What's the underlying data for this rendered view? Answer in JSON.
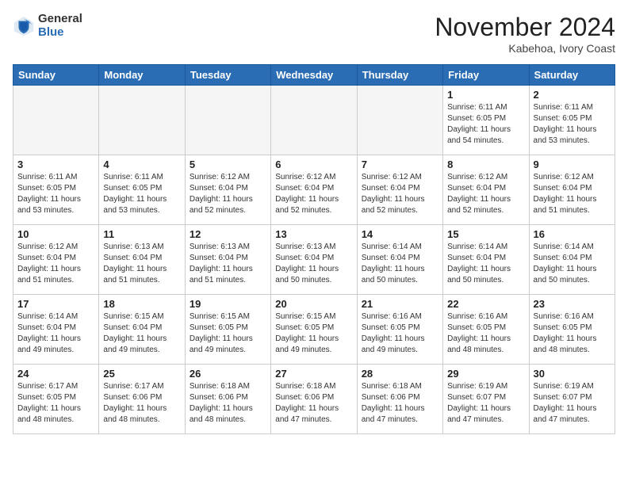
{
  "logo": {
    "general": "General",
    "blue": "Blue"
  },
  "header": {
    "month": "November 2024",
    "location": "Kabehoa, Ivory Coast"
  },
  "days_of_week": [
    "Sunday",
    "Monday",
    "Tuesday",
    "Wednesday",
    "Thursday",
    "Friday",
    "Saturday"
  ],
  "weeks": [
    [
      {
        "day": "",
        "info": ""
      },
      {
        "day": "",
        "info": ""
      },
      {
        "day": "",
        "info": ""
      },
      {
        "day": "",
        "info": ""
      },
      {
        "day": "",
        "info": ""
      },
      {
        "day": "1",
        "info": "Sunrise: 6:11 AM\nSunset: 6:05 PM\nDaylight: 11 hours\nand 54 minutes."
      },
      {
        "day": "2",
        "info": "Sunrise: 6:11 AM\nSunset: 6:05 PM\nDaylight: 11 hours\nand 53 minutes."
      }
    ],
    [
      {
        "day": "3",
        "info": "Sunrise: 6:11 AM\nSunset: 6:05 PM\nDaylight: 11 hours\nand 53 minutes."
      },
      {
        "day": "4",
        "info": "Sunrise: 6:11 AM\nSunset: 6:05 PM\nDaylight: 11 hours\nand 53 minutes."
      },
      {
        "day": "5",
        "info": "Sunrise: 6:12 AM\nSunset: 6:04 PM\nDaylight: 11 hours\nand 52 minutes."
      },
      {
        "day": "6",
        "info": "Sunrise: 6:12 AM\nSunset: 6:04 PM\nDaylight: 11 hours\nand 52 minutes."
      },
      {
        "day": "7",
        "info": "Sunrise: 6:12 AM\nSunset: 6:04 PM\nDaylight: 11 hours\nand 52 minutes."
      },
      {
        "day": "8",
        "info": "Sunrise: 6:12 AM\nSunset: 6:04 PM\nDaylight: 11 hours\nand 52 minutes."
      },
      {
        "day": "9",
        "info": "Sunrise: 6:12 AM\nSunset: 6:04 PM\nDaylight: 11 hours\nand 51 minutes."
      }
    ],
    [
      {
        "day": "10",
        "info": "Sunrise: 6:12 AM\nSunset: 6:04 PM\nDaylight: 11 hours\nand 51 minutes."
      },
      {
        "day": "11",
        "info": "Sunrise: 6:13 AM\nSunset: 6:04 PM\nDaylight: 11 hours\nand 51 minutes."
      },
      {
        "day": "12",
        "info": "Sunrise: 6:13 AM\nSunset: 6:04 PM\nDaylight: 11 hours\nand 51 minutes."
      },
      {
        "day": "13",
        "info": "Sunrise: 6:13 AM\nSunset: 6:04 PM\nDaylight: 11 hours\nand 50 minutes."
      },
      {
        "day": "14",
        "info": "Sunrise: 6:14 AM\nSunset: 6:04 PM\nDaylight: 11 hours\nand 50 minutes."
      },
      {
        "day": "15",
        "info": "Sunrise: 6:14 AM\nSunset: 6:04 PM\nDaylight: 11 hours\nand 50 minutes."
      },
      {
        "day": "16",
        "info": "Sunrise: 6:14 AM\nSunset: 6:04 PM\nDaylight: 11 hours\nand 50 minutes."
      }
    ],
    [
      {
        "day": "17",
        "info": "Sunrise: 6:14 AM\nSunset: 6:04 PM\nDaylight: 11 hours\nand 49 minutes."
      },
      {
        "day": "18",
        "info": "Sunrise: 6:15 AM\nSunset: 6:04 PM\nDaylight: 11 hours\nand 49 minutes."
      },
      {
        "day": "19",
        "info": "Sunrise: 6:15 AM\nSunset: 6:05 PM\nDaylight: 11 hours\nand 49 minutes."
      },
      {
        "day": "20",
        "info": "Sunrise: 6:15 AM\nSunset: 6:05 PM\nDaylight: 11 hours\nand 49 minutes."
      },
      {
        "day": "21",
        "info": "Sunrise: 6:16 AM\nSunset: 6:05 PM\nDaylight: 11 hours\nand 49 minutes."
      },
      {
        "day": "22",
        "info": "Sunrise: 6:16 AM\nSunset: 6:05 PM\nDaylight: 11 hours\nand 48 minutes."
      },
      {
        "day": "23",
        "info": "Sunrise: 6:16 AM\nSunset: 6:05 PM\nDaylight: 11 hours\nand 48 minutes."
      }
    ],
    [
      {
        "day": "24",
        "info": "Sunrise: 6:17 AM\nSunset: 6:05 PM\nDaylight: 11 hours\nand 48 minutes."
      },
      {
        "day": "25",
        "info": "Sunrise: 6:17 AM\nSunset: 6:06 PM\nDaylight: 11 hours\nand 48 minutes."
      },
      {
        "day": "26",
        "info": "Sunrise: 6:18 AM\nSunset: 6:06 PM\nDaylight: 11 hours\nand 48 minutes."
      },
      {
        "day": "27",
        "info": "Sunrise: 6:18 AM\nSunset: 6:06 PM\nDaylight: 11 hours\nand 47 minutes."
      },
      {
        "day": "28",
        "info": "Sunrise: 6:18 AM\nSunset: 6:06 PM\nDaylight: 11 hours\nand 47 minutes."
      },
      {
        "day": "29",
        "info": "Sunrise: 6:19 AM\nSunset: 6:07 PM\nDaylight: 11 hours\nand 47 minutes."
      },
      {
        "day": "30",
        "info": "Sunrise: 6:19 AM\nSunset: 6:07 PM\nDaylight: 11 hours\nand 47 minutes."
      }
    ]
  ]
}
